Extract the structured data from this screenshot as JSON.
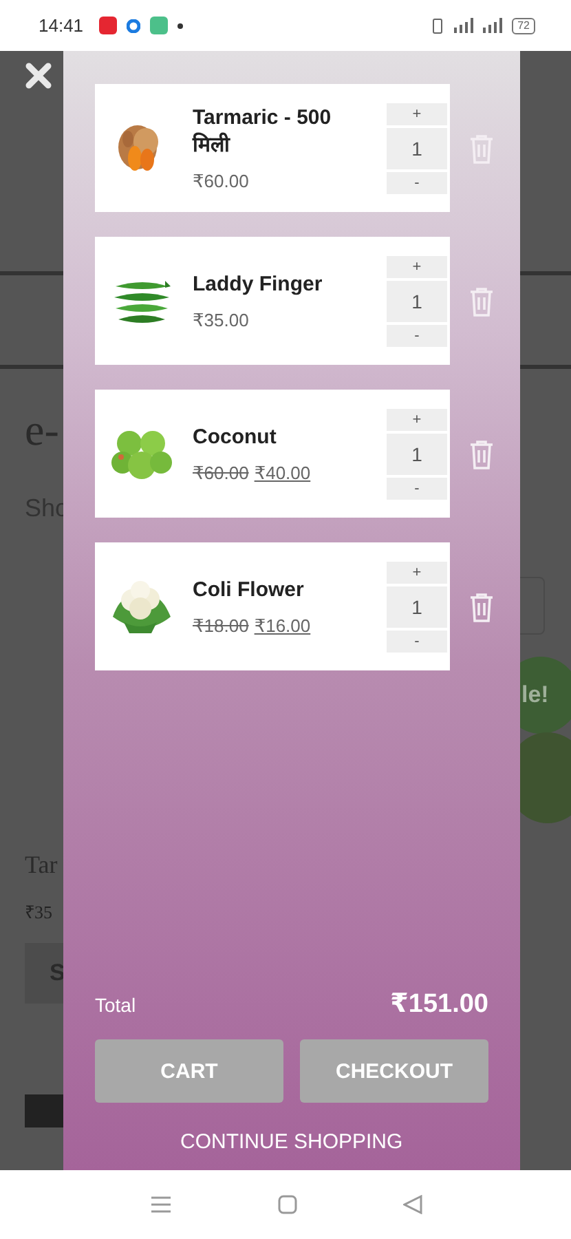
{
  "status_bar": {
    "time": "14:41",
    "battery": "72"
  },
  "background_page": {
    "heading": "e-",
    "subheading": "Sho",
    "product_name": "Tar",
    "product_price": "₹35",
    "button": "S",
    "badge": "le!"
  },
  "cart": {
    "items": [
      {
        "name": "Tarmaric - 500 मिली",
        "price": "₹60.00",
        "plus": "+",
        "quantity": "1",
        "minus": "-"
      },
      {
        "name": "Laddy Finger",
        "price": "₹35.00",
        "plus": "+",
        "quantity": "1",
        "minus": "-"
      },
      {
        "name": "Coconut",
        "old_price": "₹60.00",
        "price": "₹40.00",
        "plus": "+",
        "quantity": "1",
        "minus": "-"
      },
      {
        "name": "Coli Flower",
        "old_price": "₹18.00",
        "price": "₹16.00",
        "plus": "+",
        "quantity": "1",
        "minus": "-"
      }
    ],
    "total_label": "Total",
    "total_amount": "₹151.00",
    "buttons": [
      "CART",
      "CHECKOUT"
    ],
    "continue_link": "CONTINUE SHOPPING"
  }
}
